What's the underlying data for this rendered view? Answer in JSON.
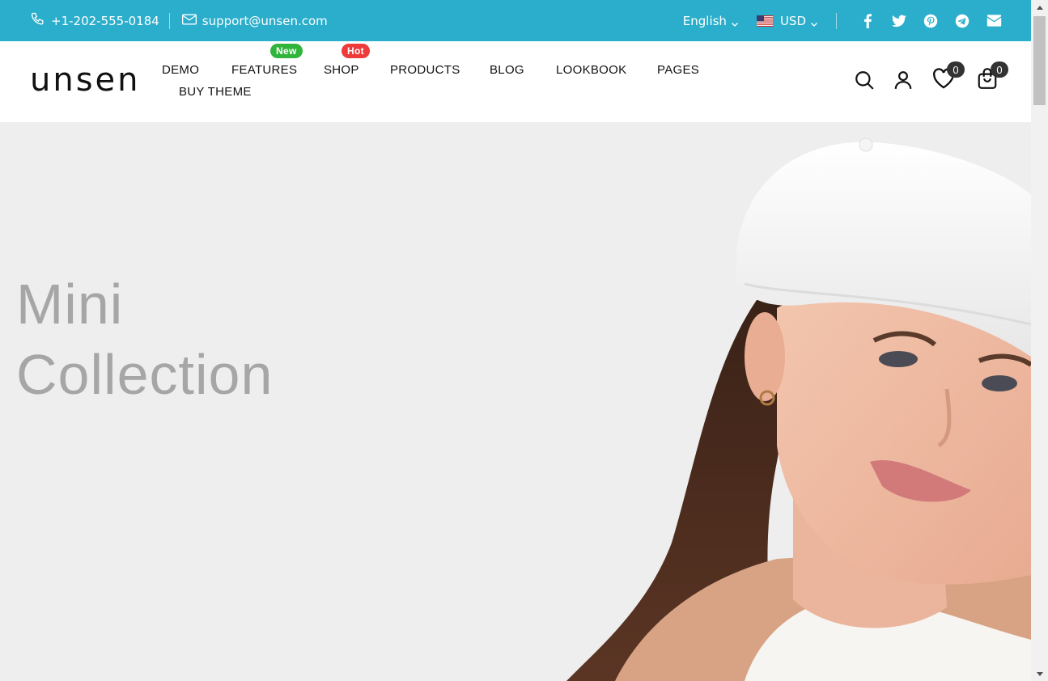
{
  "topbar": {
    "phone": "+1-202-555-0184",
    "email": "support@unsen.com",
    "language": "English",
    "currency": "USD",
    "social_icons": [
      "facebook-icon",
      "twitter-icon",
      "pinterest-icon",
      "telegram-icon",
      "envelope-icon"
    ],
    "background_color": "#2aaecb"
  },
  "header": {
    "logo": "unsen",
    "nav": [
      {
        "label": "DEMO"
      },
      {
        "label": "FEATURES",
        "badge": "New",
        "badge_color": "#31b43c"
      },
      {
        "label": "SHOP",
        "badge": "Hot",
        "badge_color": "#ee3a3a"
      },
      {
        "label": "PRODUCTS"
      },
      {
        "label": "BLOG"
      },
      {
        "label": "LOOKBOOK"
      },
      {
        "label": "PAGES"
      },
      {
        "label": "BUY THEME"
      }
    ],
    "wishlist_count": "0",
    "cart_count": "0"
  },
  "hero": {
    "title_line1": "Mini",
    "title_line2": "Collection"
  }
}
